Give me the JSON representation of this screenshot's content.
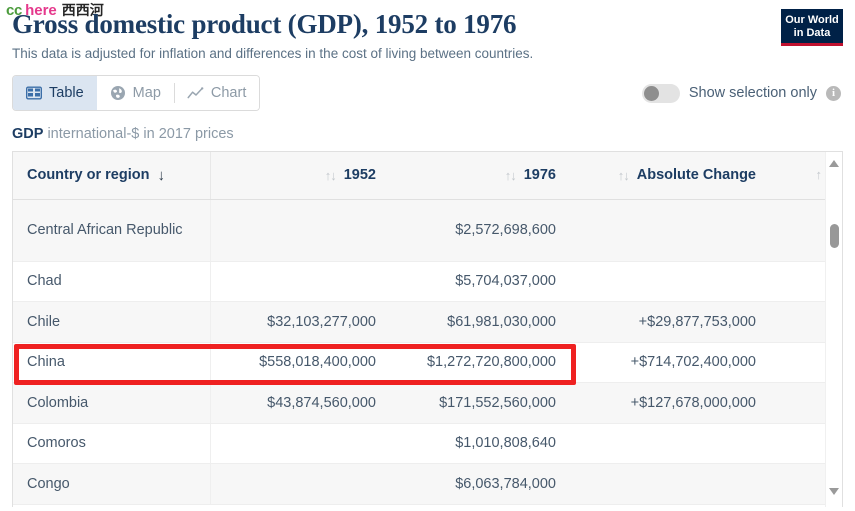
{
  "watermark": {
    "part1": "cc",
    "part2": "here",
    "part3": "西西河"
  },
  "logo": {
    "line1": "Our World",
    "line2": "in Data"
  },
  "header": {
    "title": "Gross domestic product (GDP), 1952 to 1976",
    "subtitle": "This data is adjusted for inflation and differences in the cost of living between countries."
  },
  "tabs": [
    {
      "label": "Table",
      "icon": "table-icon",
      "active": true
    },
    {
      "label": "Map",
      "icon": "globe-icon",
      "active": false
    },
    {
      "label": "Chart",
      "icon": "line-chart-icon",
      "active": false
    }
  ],
  "selection_toggle": {
    "label": "Show selection only",
    "state": "off",
    "info_glyph": "i"
  },
  "unit_caption": {
    "metric": "GDP",
    "unit": "international-$ in 2017 prices"
  },
  "table": {
    "columns": [
      {
        "label": "Country or region",
        "sort": "desc-active",
        "align": "left"
      },
      {
        "label": "1952",
        "sort": "both",
        "align": "right"
      },
      {
        "label": "1976",
        "sort": "both",
        "align": "right"
      },
      {
        "label": "Absolute Change",
        "sort": "both",
        "align": "right"
      },
      {
        "label": "",
        "sort": "both",
        "align": "right"
      }
    ],
    "rows": [
      {
        "country": "Central African Republic",
        "v1952": "",
        "v1976": "$2,572,698,600",
        "absolute_change": "",
        "relative_change": ""
      },
      {
        "country": "Chad",
        "v1952": "",
        "v1976": "$5,704,037,000",
        "absolute_change": "",
        "relative_change": ""
      },
      {
        "country": "Chile",
        "v1952": "$32,103,277,000",
        "v1976": "$61,981,030,000",
        "absolute_change": "+$29,877,753,000",
        "relative_change": ""
      },
      {
        "country": "China",
        "v1952": "$558,018,400,000",
        "v1976": "$1,272,720,800,000",
        "absolute_change": "+$714,702,400,000",
        "relative_change": ""
      },
      {
        "country": "Colombia",
        "v1952": "$43,874,560,000",
        "v1976": "$171,552,560,000",
        "absolute_change": "+$127,678,000,000",
        "relative_change": ""
      },
      {
        "country": "Comoros",
        "v1952": "",
        "v1976": "$1,010,808,640",
        "absolute_change": "",
        "relative_change": ""
      },
      {
        "country": "Congo",
        "v1952": "",
        "v1976": "$6,063,784,000",
        "absolute_change": "",
        "relative_change": ""
      }
    ]
  },
  "annotation": {
    "color": "#ef2121",
    "target_row": "China"
  }
}
